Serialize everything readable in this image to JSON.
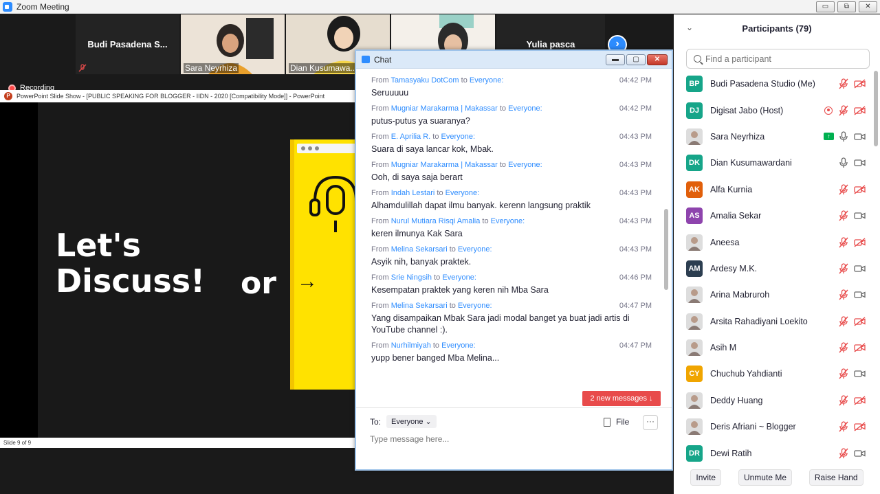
{
  "window": {
    "title": "Zoom Meeting",
    "btn_min": "▭",
    "btn_max": "⧉",
    "btn_close": "✕"
  },
  "gallery": {
    "thumbs": [
      {
        "name": "Budi Pasadena S...",
        "type": "name"
      },
      {
        "name": "Sara Neyrhiza",
        "type": "video"
      },
      {
        "name": "Dian Kusumawa...",
        "type": "video"
      },
      {
        "name": "",
        "type": "video"
      },
      {
        "name": "Yulia pasca",
        "type": "name"
      }
    ],
    "next_label": "›"
  },
  "recording": {
    "label": "Recording"
  },
  "powerpoint": {
    "window_title": "PowerPoint Slide Show - [PUBLIC SPEAKING FOR BLOGGER - IIDN - 2020 [Compatibility Mode]] - PowerPoint",
    "icon_letter": "P",
    "slide_line1": "Let's",
    "slide_line2": "Discuss!",
    "slide_or": "or",
    "arrow": "→",
    "footer": "Slide 9 of 9"
  },
  "chat": {
    "title": "Chat",
    "btn_min": "▬",
    "btn_max": "▢",
    "btn_close": "✕",
    "from_label": "From",
    "to_label": "to",
    "messages": [
      {
        "from": "Tamasyaku DotCom",
        "to": "Everyone:",
        "time": "04:42 PM",
        "text": "Seruuuuu"
      },
      {
        "from": "Mugniar Marakarma | Makassar",
        "to": "Everyone:",
        "time": "04:42 PM",
        "text": "putus-putus ya suaranya?"
      },
      {
        "from": "E. Aprilia R.",
        "to": "Everyone:",
        "time": "04:43 PM",
        "text": "Suara di saya lancar kok, Mbak."
      },
      {
        "from": "Mugniar Marakarma | Makassar",
        "to": "Everyone:",
        "time": "04:43 PM",
        "text": "Ooh,  di saya saja berart"
      },
      {
        "from": "Indah Lestari",
        "to": "Everyone:",
        "time": "04:43 PM",
        "text": "Alhamdulillah dapat ilmu banyak. kerenn langsung praktik"
      },
      {
        "from": "Nurul Mutiara Risqi Amalia",
        "to": "Everyone:",
        "time": "04:43 PM",
        "text": "keren ilmunya Kak Sara"
      },
      {
        "from": "Melina Sekarsari",
        "to": "Everyone:",
        "time": "04:43 PM",
        "text": "Asyik nih, banyak praktek."
      },
      {
        "from": "Srie Ningsih",
        "to": "Everyone:",
        "time": "04:46 PM",
        "text": "Kesempatan praktek yang keren nih Mba Sara"
      },
      {
        "from": "Melina Sekarsari",
        "to": "Everyone:",
        "time": "04:47 PM",
        "text": "Yang disampaikan Mbak Sara jadi modal banget ya buat jadi artis di YouTube channel :)."
      },
      {
        "from": "Nurhilmiyah ",
        "to": "Everyone:",
        "time": "04:47 PM",
        "text": "yupp bener banged Mba Melina..."
      }
    ],
    "new_messages": "2 new messages ↓",
    "to_prefix": "To:",
    "to_value": "Everyone ⌄",
    "file_label": "File",
    "more_label": "···",
    "input_placeholder": "Type message here..."
  },
  "participants": {
    "title": "Participants (79)",
    "collapse": "⌄",
    "search_placeholder": "Find a participant",
    "list": [
      {
        "initials": "BP",
        "color": "#16a589",
        "name": "Budi Pasadena Studio (Me)",
        "mic": "off",
        "cam": "off"
      },
      {
        "initials": "DJ",
        "color": "#16a589",
        "name": "Digisat Jabo (Host)",
        "mic": "off",
        "cam": "off",
        "host": true
      },
      {
        "initials": "",
        "color": "#ddd",
        "name": "Sara Neyrhiza",
        "mic": "on",
        "cam": "on",
        "photo": true,
        "share": true
      },
      {
        "initials": "DK",
        "color": "#16a589",
        "name": "Dian Kusumawardani",
        "mic": "on",
        "cam": "on"
      },
      {
        "initials": "AK",
        "color": "#e15f0a",
        "name": "Alfa Kurnia",
        "mic": "off",
        "cam": "off"
      },
      {
        "initials": "AS",
        "color": "#8e44ad",
        "name": "Amalia Sekar",
        "mic": "off",
        "cam": "on"
      },
      {
        "initials": "",
        "color": "#ddd",
        "name": "Aneesa",
        "mic": "off",
        "cam": "off",
        "photo": true
      },
      {
        "initials": "AM",
        "color": "#2c3e50",
        "name": "Ardesy M.K.",
        "mic": "off",
        "cam": "on"
      },
      {
        "initials": "",
        "color": "#ddd",
        "name": "Arina Mabruroh",
        "mic": "off",
        "cam": "on",
        "photo": true
      },
      {
        "initials": "",
        "color": "#ddd",
        "name": "Arsita Rahadiyani Loekito",
        "mic": "off",
        "cam": "off",
        "photo": true
      },
      {
        "initials": "",
        "color": "#ddd",
        "name": "Asih M",
        "mic": "off",
        "cam": "off",
        "photo": true
      },
      {
        "initials": "CY",
        "color": "#f0a500",
        "name": "Chuchub Yahdianti",
        "mic": "off",
        "cam": "on"
      },
      {
        "initials": "",
        "color": "#ddd",
        "name": "Deddy Huang",
        "mic": "off",
        "cam": "off",
        "photo": true
      },
      {
        "initials": "",
        "color": "#ddd",
        "name": "Deris Afriani ~ Blogger",
        "mic": "off",
        "cam": "off",
        "photo": true
      },
      {
        "initials": "DR",
        "color": "#16a589",
        "name": "Dewi Ratih",
        "mic": "off",
        "cam": "on"
      }
    ],
    "footer": {
      "invite": "Invite",
      "unmute": "Unmute Me",
      "raise": "Raise Hand"
    }
  }
}
